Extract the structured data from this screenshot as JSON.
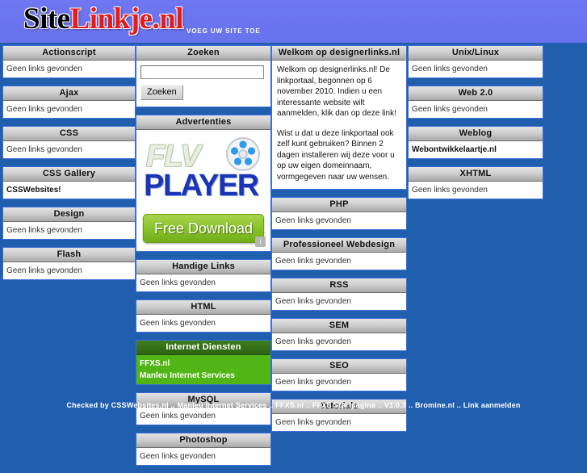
{
  "header": {
    "logo_primary": "Site",
    "logo_secondary": "Linkje.nl",
    "tagline": "VOEG UW SITE TOE",
    "background_color": "#6b74ef",
    "logo_primary_color": "#000000",
    "logo_secondary_color": "#e41b1b"
  },
  "theme": {
    "page_background": "#1f5fad",
    "block_border": "#3d6fd6",
    "block_head_gradient_top": "#e2e2e2",
    "block_head_gradient_bottom": "#a9a9a9",
    "highlight_head": "#2f6b14",
    "highlight_body": "#52b516"
  },
  "empty_text": "Geen links gevonden",
  "columns": [
    {
      "id": "column-1",
      "blocks": [
        {
          "type": "links",
          "title": "Actionscript",
          "links": [],
          "empty": "Geen links gevonden"
        },
        {
          "type": "links",
          "title": "Ajax",
          "links": [],
          "empty": "Geen links gevonden"
        },
        {
          "type": "links",
          "title": "CSS",
          "links": [],
          "empty": "Geen links gevonden"
        },
        {
          "type": "links",
          "title": "CSS Gallery",
          "links": [
            "CSSWebsites!"
          ],
          "empty": ""
        },
        {
          "type": "links",
          "title": "Design",
          "links": [],
          "empty": "Geen links gevonden"
        },
        {
          "type": "links",
          "title": "Flash",
          "links": [],
          "empty": "Geen links gevonden"
        }
      ]
    },
    {
      "id": "column-2",
      "blocks": [
        {
          "type": "search",
          "title": "Zoeken",
          "input_value": "",
          "input_placeholder": "",
          "button_label": "Zoeken"
        },
        {
          "type": "advert",
          "title": "Advertenties",
          "ad": {
            "line1": "FLV",
            "line2": "PLAYER",
            "button_label": "Free Download",
            "choices_glyph": "i",
            "reel_name": "film-reel-icon"
          }
        },
        {
          "type": "links",
          "title": "Handige Links",
          "links": [],
          "empty": "Geen links gevonden"
        },
        {
          "type": "links",
          "title": "HTML",
          "links": [],
          "empty": "Geen links gevonden"
        },
        {
          "type": "links",
          "title": "Internet Diensten",
          "highlight": true,
          "links": [
            "FFXS.nl",
            "Manleu Internet Services"
          ],
          "empty": ""
        },
        {
          "type": "links",
          "title": "MySQL",
          "links": [],
          "empty": "Geen links gevonden"
        },
        {
          "type": "links",
          "title": "Photoshop",
          "links": [],
          "empty": "Geen links gevonden"
        }
      ]
    },
    {
      "id": "column-3",
      "blocks": [
        {
          "type": "welcome",
          "title": "Welkom op designerlinks.nl",
          "paragraphs": [
            "Welkom op designerlinks.nl! De linkportaal, begonnen op 6 november 2010. Indien u een interessante website wilt aanmelden, klik dan op deze link!",
            "Wist u dat u deze linkportaal ook zelf kunt gebruiken? Binnen 2 dagen installeren wij deze voor u op uw eigen domeinnaam, vormgegeven naar uw wensen."
          ]
        },
        {
          "type": "links",
          "title": "PHP",
          "links": [],
          "empty": "Geen links gevonden"
        },
        {
          "type": "links",
          "title": "Professioneel Webdesign",
          "links": [],
          "empty": "Geen links gevonden"
        },
        {
          "type": "links",
          "title": "RSS",
          "links": [],
          "empty": "Geen links gevonden"
        },
        {
          "type": "links",
          "title": "SEM",
          "links": [],
          "empty": "Geen links gevonden"
        },
        {
          "type": "links",
          "title": "SEO",
          "links": [],
          "empty": "Geen links gevonden"
        },
        {
          "type": "links",
          "title": "Tutorials",
          "links": [],
          "empty": "Geen links gevonden"
        }
      ]
    },
    {
      "id": "column-4",
      "blocks": [
        {
          "type": "links",
          "title": "Unix/Linux",
          "links": [],
          "empty": "Geen links gevonden"
        },
        {
          "type": "links",
          "title": "Web 2.0",
          "links": [],
          "empty": "Geen links gevonden"
        },
        {
          "type": "links",
          "title": "Weblog",
          "links": [
            "Webontwikkelaartje.nl"
          ],
          "empty": ""
        },
        {
          "type": "links",
          "title": "XHTML",
          "links": [],
          "empty": "Geen links gevonden"
        }
      ]
    }
  ],
  "footer": {
    "text": "Checked by CSSWebsites.nl .. Manleu Internet Services .. FFXS.nl .. FFXS Startpagina .. V1.0.3 .. Bromine.nl .. Link aanmelden",
    "items": [
      "Checked by CSSWebsites.nl",
      "Manleu Internet Services",
      "FFXS.nl",
      "FFXS Startpagina",
      "V1.0.3",
      "Bromine.nl",
      "Link aanmelden"
    ],
    "separator": " .. "
  }
}
